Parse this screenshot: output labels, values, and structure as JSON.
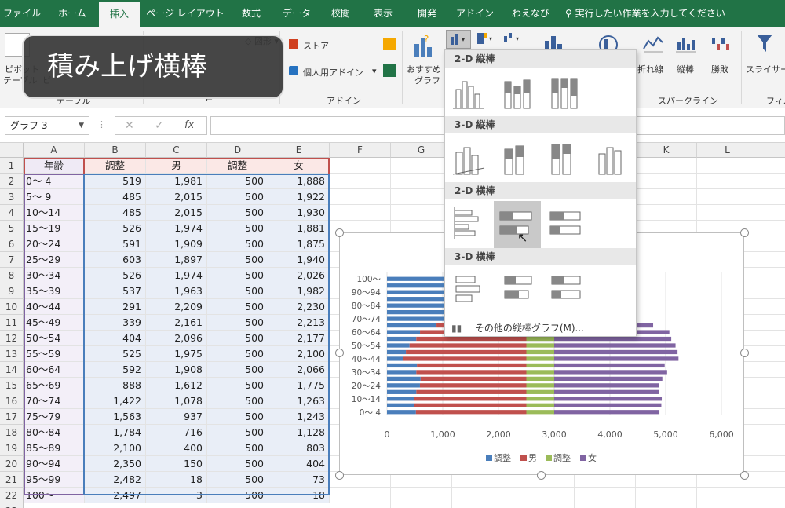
{
  "ribbon_tabs": [
    "ファイル",
    "ホーム",
    "挿入",
    "ページ レイアウト",
    "数式",
    "データ",
    "校閲",
    "表示",
    "開発",
    "アドイン",
    "わえなび"
  ],
  "tell_me": "実行したい作業を入力してください",
  "ribbon": {
    "pivot_label_1": "ピボット",
    "pivot_label_2": "テーブル",
    "pivot_label_3": "ピ",
    "group_table": "テーブル",
    "group_addin": "アドイン",
    "store": "ストア",
    "my_addins": "個人用アドイン",
    "rec_chart_1": "おすすめ",
    "rec_chart_2": "グラフ",
    "shapes": "図形",
    "spark_line": "折れ線",
    "spark_column": "縦棒",
    "spark_winloss": "勝敗",
    "group_sparkline": "スパークライン",
    "slicer": "スライサー",
    "group_filter": "フィル"
  },
  "overlay_caption": "積み上げ横棒",
  "name_box": "グラフ 3",
  "formula_icons": [
    "✕",
    "✓",
    "fx"
  ],
  "columns": [
    "A",
    "B",
    "C",
    "D",
    "E",
    "F",
    "G",
    "H",
    "I",
    "J",
    "K",
    "L",
    "M"
  ],
  "header_row": [
    "年齢",
    "調整",
    "男",
    "調整",
    "女"
  ],
  "rows": [
    [
      "0～ 4",
      "519",
      "1,981",
      "500",
      "1,888"
    ],
    [
      "5～ 9",
      "485",
      "2,015",
      "500",
      "1,922"
    ],
    [
      "10～14",
      "485",
      "2,015",
      "500",
      "1,930"
    ],
    [
      "15～19",
      "526",
      "1,974",
      "500",
      "1,881"
    ],
    [
      "20～24",
      "591",
      "1,909",
      "500",
      "1,875"
    ],
    [
      "25～29",
      "603",
      "1,897",
      "500",
      "1,940"
    ],
    [
      "30～34",
      "526",
      "1,974",
      "500",
      "2,026"
    ],
    [
      "35～39",
      "537",
      "1,963",
      "500",
      "1,982"
    ],
    [
      "40～44",
      "291",
      "2,209",
      "500",
      "2,230"
    ],
    [
      "45～49",
      "339",
      "2,161",
      "500",
      "2,213"
    ],
    [
      "50～54",
      "404",
      "2,096",
      "500",
      "2,177"
    ],
    [
      "55～59",
      "525",
      "1,975",
      "500",
      "2,100"
    ],
    [
      "60～64",
      "592",
      "1,908",
      "500",
      "2,066"
    ],
    [
      "65～69",
      "888",
      "1,612",
      "500",
      "1,775"
    ],
    [
      "70～74",
      "1,422",
      "1,078",
      "500",
      "1,263"
    ],
    [
      "75～79",
      "1,563",
      "937",
      "500",
      "1,243"
    ],
    [
      "80～84",
      "1,784",
      "716",
      "500",
      "1,128"
    ],
    [
      "85～89",
      "2,100",
      "400",
      "500",
      "803"
    ],
    [
      "90～94",
      "2,350",
      "150",
      "500",
      "404"
    ],
    [
      "95～99",
      "2,482",
      "18",
      "500",
      "73"
    ],
    [
      "100～",
      "2,497",
      "3",
      "500",
      "18"
    ]
  ],
  "dropdown": {
    "sec1": "2-D 縦棒",
    "sec2": "3-D 縦棒",
    "sec3": "2-D 横棒",
    "sec4": "3-D 横棒",
    "more": "その他の縦棒グラフ(M)..."
  },
  "colors": {
    "adj1": "#4a7ebb",
    "male": "#c0504d",
    "adj2": "#9bbb59",
    "female": "#8064a2",
    "excel_green": "#217346"
  },
  "chart_data": {
    "type": "bar",
    "orientation": "horizontal",
    "stacked": true,
    "categories": [
      "0～ 4",
      "5～ 9",
      "10～14",
      "15～19",
      "20～24",
      "25～29",
      "30～34",
      "35～39",
      "40～44",
      "45～49",
      "50～54",
      "55～59",
      "60～64",
      "65～69",
      "70～74",
      "75～79",
      "80～84",
      "85～89",
      "90～94",
      "95～99",
      "100～"
    ],
    "visible_category_labels": [
      "0～ 4",
      "10～14",
      "20～24",
      "30～34",
      "40～44",
      "50～54",
      "60～64",
      "70～74",
      "80～84",
      "90～94",
      "100～"
    ],
    "series": [
      {
        "name": "調整",
        "color": "#4a7ebb",
        "values": [
          519,
          485,
          485,
          526,
          591,
          603,
          526,
          537,
          291,
          339,
          404,
          525,
          592,
          888,
          1422,
          1563,
          1784,
          2100,
          2350,
          2482,
          2497
        ]
      },
      {
        "name": "男",
        "color": "#c0504d",
        "values": [
          1981,
          2015,
          2015,
          1974,
          1909,
          1897,
          1974,
          1963,
          2209,
          2161,
          2096,
          1975,
          1908,
          1612,
          1078,
          937,
          716,
          400,
          150,
          18,
          3
        ]
      },
      {
        "name": "調整",
        "color": "#9bbb59",
        "values": [
          500,
          500,
          500,
          500,
          500,
          500,
          500,
          500,
          500,
          500,
          500,
          500,
          500,
          500,
          500,
          500,
          500,
          500,
          500,
          500,
          500
        ]
      },
      {
        "name": "女",
        "color": "#8064a2",
        "values": [
          1888,
          1922,
          1930,
          1881,
          1875,
          1940,
          2026,
          1982,
          2230,
          2213,
          2177,
          2100,
          2066,
          1775,
          1263,
          1243,
          1128,
          803,
          404,
          73,
          18
        ]
      }
    ],
    "x_ticks": [
      "0",
      "1,000",
      "2,000",
      "3,000",
      "4,000",
      "5,000",
      "6,000"
    ],
    "xlim": [
      0,
      6000
    ],
    "grid": true,
    "legend": "bottom"
  }
}
